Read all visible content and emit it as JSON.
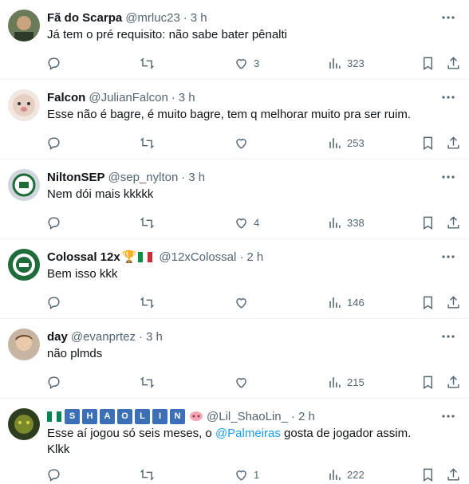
{
  "tweets": [
    {
      "name": "Fã do Scarpa",
      "handle": "@mrluc23",
      "time": "3 h",
      "text": "Já tem o pré requisito: não sabe bater pênalti",
      "likes": "3",
      "views": "323",
      "avatar_color": "#4a5a3a"
    },
    {
      "name": "Falcon",
      "handle": "@JulianFalcon",
      "time": "3 h",
      "text": "Esse não é bagre, é muito bagre, tem q melhorar muito pra ser ruim.",
      "likes": "",
      "views": "253",
      "avatar_color": "#e8d6cc"
    },
    {
      "name": "NiltonSEP",
      "handle": "@sep_nylton",
      "time": "3 h",
      "text": "Nem dói mais kkkkk",
      "likes": "4",
      "views": "338",
      "avatar_color": "#d7dde3"
    },
    {
      "name": "Colossal 12x",
      "handle": "@12xColossal",
      "time": "2 h",
      "text": "Bem isso kkk",
      "likes": "",
      "views": "146",
      "avatar_color": "#1f6b3a",
      "trophy": "🏆"
    },
    {
      "name": "day",
      "handle": "@evanprtez",
      "time": "3 h",
      "text": "não plmds",
      "likes": "",
      "views": "215",
      "avatar_color": "#b9a28c"
    },
    {
      "name_letters": [
        "S",
        "H",
        "A",
        "O",
        "L",
        "I",
        "N"
      ],
      "handle": "@Lil_ShaoLin_",
      "time": "2 h",
      "text_before": "Esse aí jogou só seis meses, o ",
      "mention": "@Palmeiras",
      "text_after": " gosta de jogador assim. Klkk",
      "likes": "1",
      "views": "222",
      "avatar_color": "#2f3d1f"
    }
  ],
  "dot": "·",
  "colors": {
    "text": "#0f1419",
    "muted": "#536471",
    "link": "#1d9bf0",
    "tag": "#3b6fb6"
  }
}
